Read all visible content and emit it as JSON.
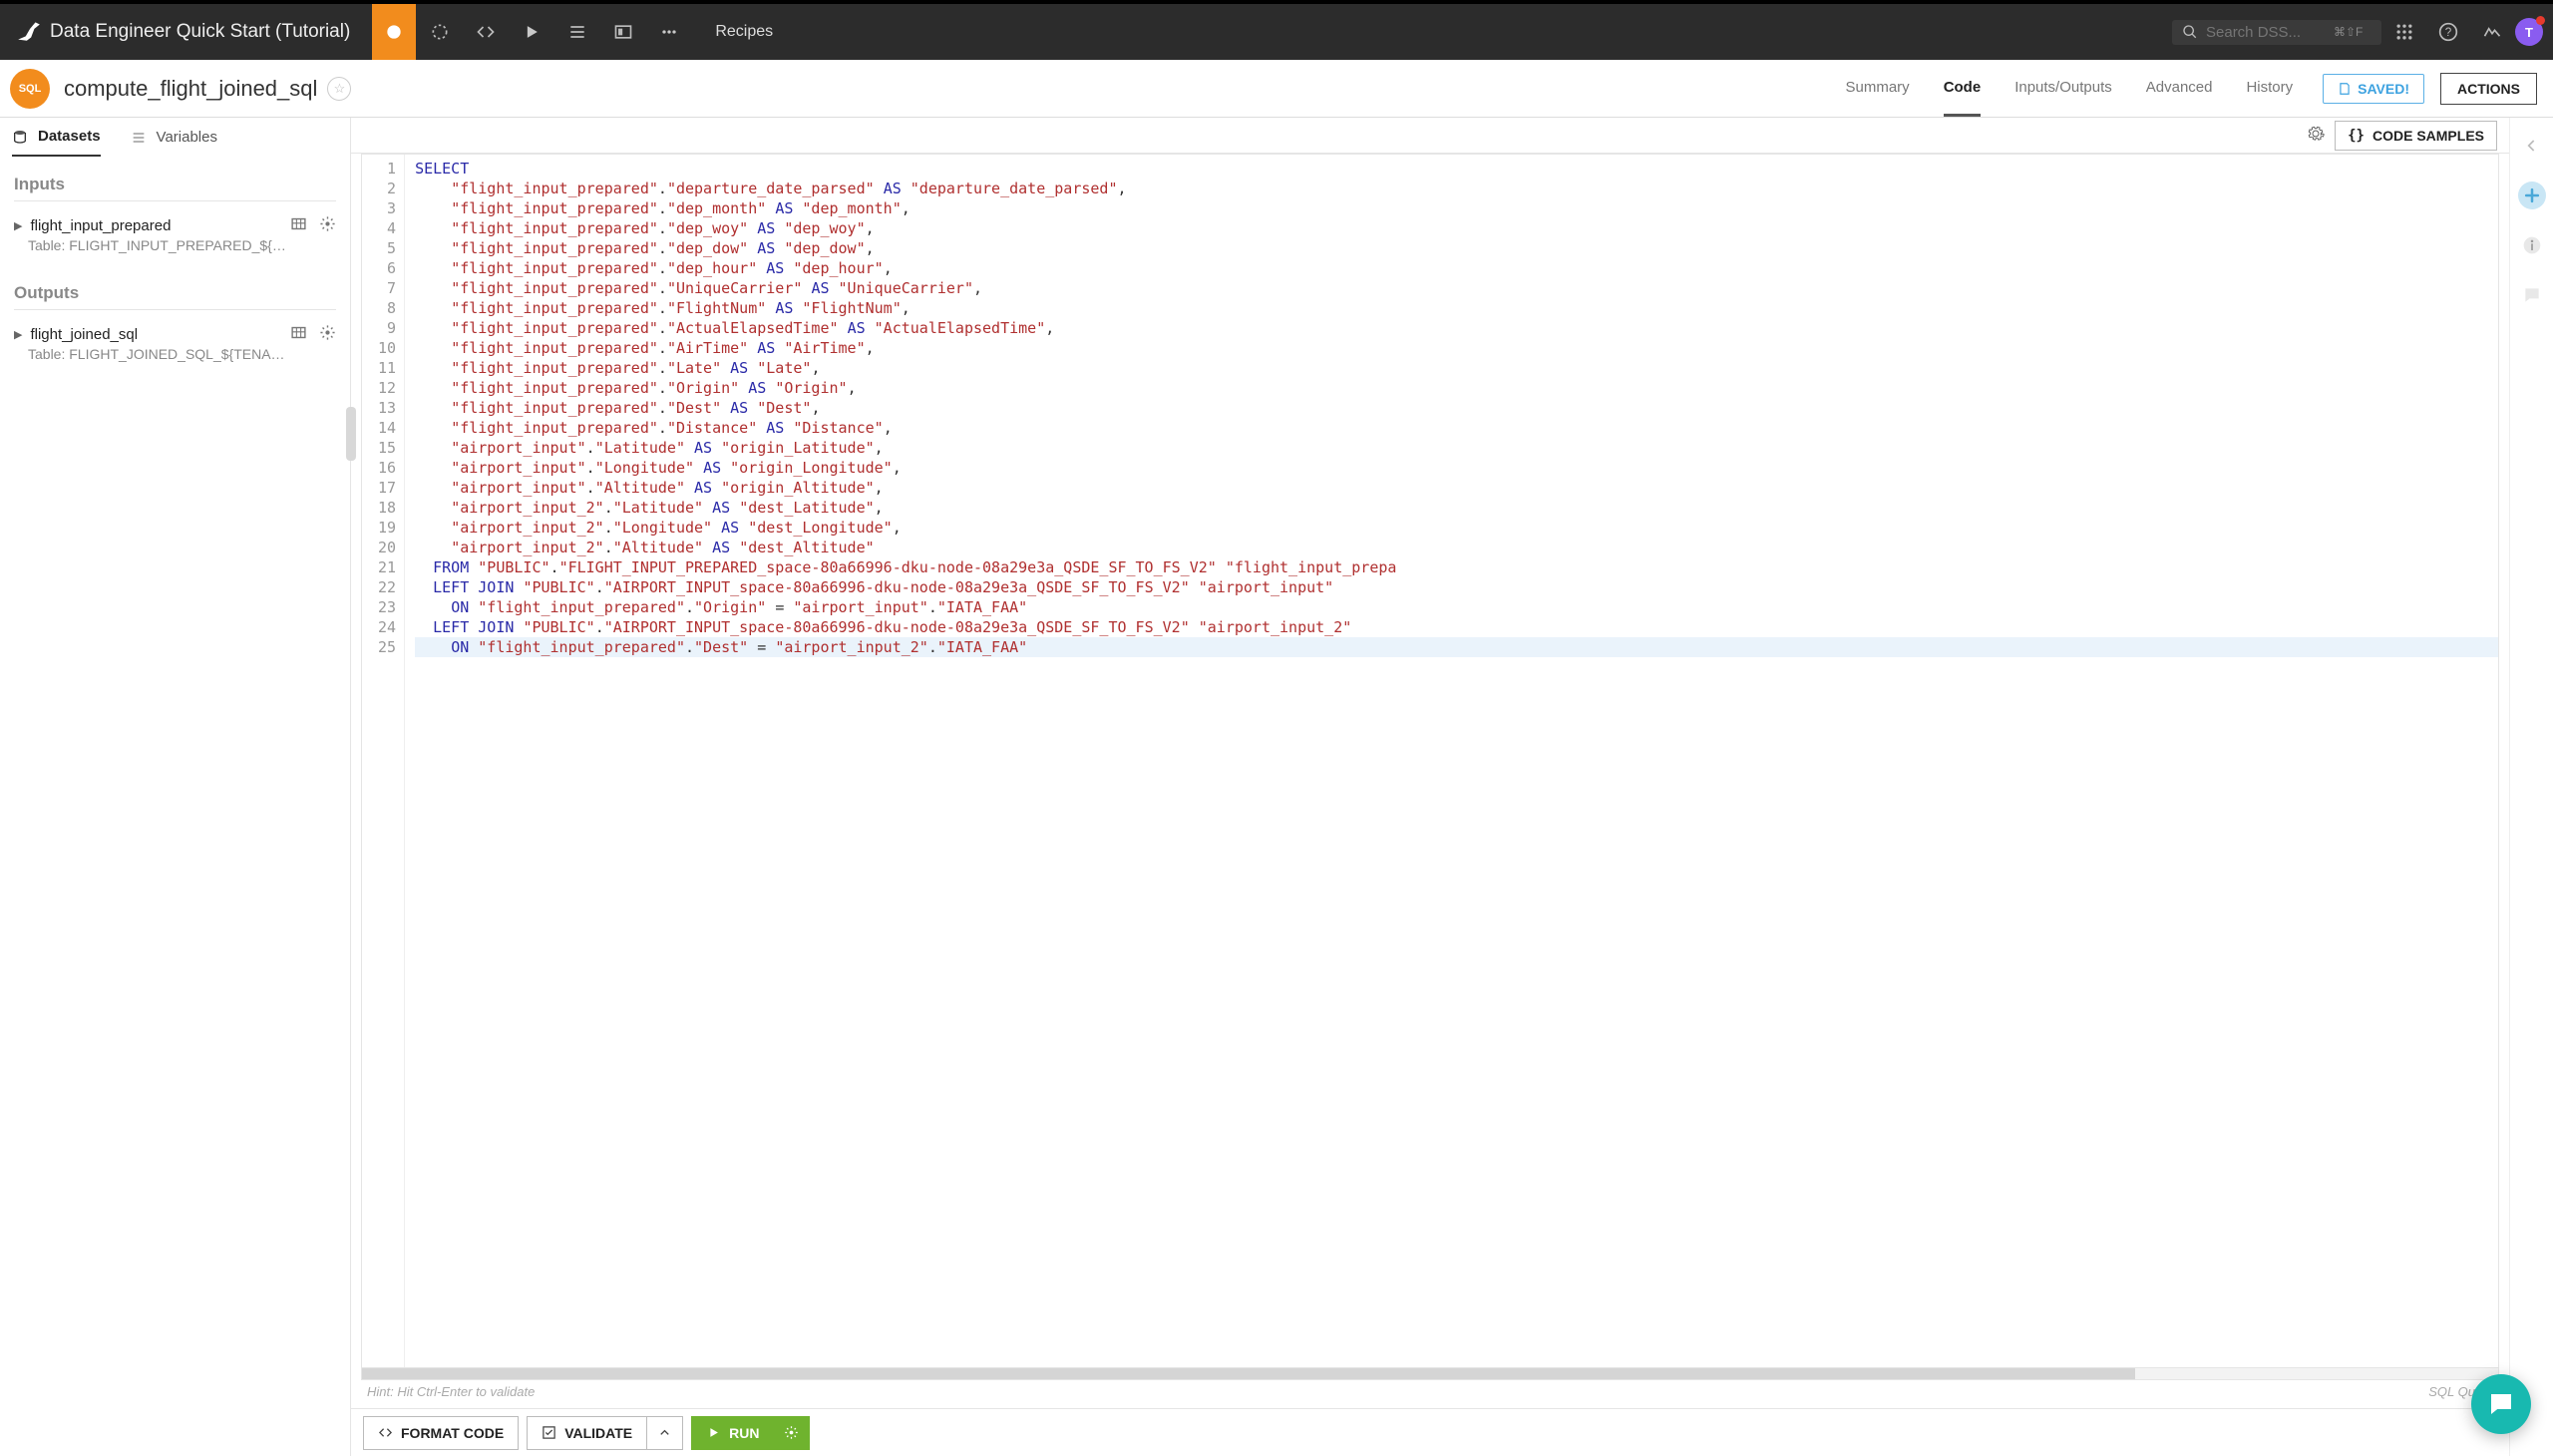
{
  "project_title": "Data Engineer Quick Start (Tutorial)",
  "top_tab": "Recipes",
  "search": {
    "placeholder": "Search DSS...",
    "kbd": "⌘⇧F"
  },
  "avatar_initial": "T",
  "recipe": {
    "chip": "SQL",
    "name": "compute_flight_joined_sql"
  },
  "subtabs": [
    "Summary",
    "Code",
    "Inputs/Outputs",
    "Advanced",
    "History"
  ],
  "subtab_active": 1,
  "saved_label": "SAVED!",
  "actions_label": "ACTIONS",
  "side_tabs": {
    "datasets": "Datasets",
    "variables": "Variables",
    "active": "datasets"
  },
  "inputs_title": "Inputs",
  "outputs_title": "Outputs",
  "inputs": [
    {
      "name": "flight_input_prepared",
      "table": "Table: FLIGHT_INPUT_PREPARED_${…"
    }
  ],
  "outputs": [
    {
      "name": "flight_joined_sql",
      "table": "Table: FLIGHT_JOINED_SQL_${TENA…"
    }
  ],
  "code_samples_label": "CODE SAMPLES",
  "hint": "Hint: Hit Ctrl-Enter to validate",
  "hint_right": "SQL Query",
  "format_label": "FORMAT CODE",
  "validate_label": "VALIDATE",
  "run_label": "RUN",
  "code": {
    "lines": [
      {
        "n": 1,
        "t": [
          [
            "kw",
            "SELECT"
          ]
        ]
      },
      {
        "n": 2,
        "t": [
          [
            "sp",
            "    "
          ],
          [
            "str",
            "\"flight_input_prepared\""
          ],
          [
            "op",
            "."
          ],
          [
            "str",
            "\"departure_date_parsed\""
          ],
          [
            "sp",
            " "
          ],
          [
            "kw",
            "AS"
          ],
          [
            "sp",
            " "
          ],
          [
            "str",
            "\"departure_date_parsed\""
          ],
          [
            "op",
            ","
          ]
        ]
      },
      {
        "n": 3,
        "t": [
          [
            "sp",
            "    "
          ],
          [
            "str",
            "\"flight_input_prepared\""
          ],
          [
            "op",
            "."
          ],
          [
            "str",
            "\"dep_month\""
          ],
          [
            "sp",
            " "
          ],
          [
            "kw",
            "AS"
          ],
          [
            "sp",
            " "
          ],
          [
            "str",
            "\"dep_month\""
          ],
          [
            "op",
            ","
          ]
        ]
      },
      {
        "n": 4,
        "t": [
          [
            "sp",
            "    "
          ],
          [
            "str",
            "\"flight_input_prepared\""
          ],
          [
            "op",
            "."
          ],
          [
            "str",
            "\"dep_woy\""
          ],
          [
            "sp",
            " "
          ],
          [
            "kw",
            "AS"
          ],
          [
            "sp",
            " "
          ],
          [
            "str",
            "\"dep_woy\""
          ],
          [
            "op",
            ","
          ]
        ]
      },
      {
        "n": 5,
        "t": [
          [
            "sp",
            "    "
          ],
          [
            "str",
            "\"flight_input_prepared\""
          ],
          [
            "op",
            "."
          ],
          [
            "str",
            "\"dep_dow\""
          ],
          [
            "sp",
            " "
          ],
          [
            "kw",
            "AS"
          ],
          [
            "sp",
            " "
          ],
          [
            "str",
            "\"dep_dow\""
          ],
          [
            "op",
            ","
          ]
        ]
      },
      {
        "n": 6,
        "t": [
          [
            "sp",
            "    "
          ],
          [
            "str",
            "\"flight_input_prepared\""
          ],
          [
            "op",
            "."
          ],
          [
            "str",
            "\"dep_hour\""
          ],
          [
            "sp",
            " "
          ],
          [
            "kw",
            "AS"
          ],
          [
            "sp",
            " "
          ],
          [
            "str",
            "\"dep_hour\""
          ],
          [
            "op",
            ","
          ]
        ]
      },
      {
        "n": 7,
        "t": [
          [
            "sp",
            "    "
          ],
          [
            "str",
            "\"flight_input_prepared\""
          ],
          [
            "op",
            "."
          ],
          [
            "str",
            "\"UniqueCarrier\""
          ],
          [
            "sp",
            " "
          ],
          [
            "kw",
            "AS"
          ],
          [
            "sp",
            " "
          ],
          [
            "str",
            "\"UniqueCarrier\""
          ],
          [
            "op",
            ","
          ]
        ]
      },
      {
        "n": 8,
        "t": [
          [
            "sp",
            "    "
          ],
          [
            "str",
            "\"flight_input_prepared\""
          ],
          [
            "op",
            "."
          ],
          [
            "str",
            "\"FlightNum\""
          ],
          [
            "sp",
            " "
          ],
          [
            "kw",
            "AS"
          ],
          [
            "sp",
            " "
          ],
          [
            "str",
            "\"FlightNum\""
          ],
          [
            "op",
            ","
          ]
        ]
      },
      {
        "n": 9,
        "t": [
          [
            "sp",
            "    "
          ],
          [
            "str",
            "\"flight_input_prepared\""
          ],
          [
            "op",
            "."
          ],
          [
            "str",
            "\"ActualElapsedTime\""
          ],
          [
            "sp",
            " "
          ],
          [
            "kw",
            "AS"
          ],
          [
            "sp",
            " "
          ],
          [
            "str",
            "\"ActualElapsedTime\""
          ],
          [
            "op",
            ","
          ]
        ]
      },
      {
        "n": 10,
        "t": [
          [
            "sp",
            "    "
          ],
          [
            "str",
            "\"flight_input_prepared\""
          ],
          [
            "op",
            "."
          ],
          [
            "str",
            "\"AirTime\""
          ],
          [
            "sp",
            " "
          ],
          [
            "kw",
            "AS"
          ],
          [
            "sp",
            " "
          ],
          [
            "str",
            "\"AirTime\""
          ],
          [
            "op",
            ","
          ]
        ]
      },
      {
        "n": 11,
        "t": [
          [
            "sp",
            "    "
          ],
          [
            "str",
            "\"flight_input_prepared\""
          ],
          [
            "op",
            "."
          ],
          [
            "str",
            "\"Late\""
          ],
          [
            "sp",
            " "
          ],
          [
            "kw",
            "AS"
          ],
          [
            "sp",
            " "
          ],
          [
            "str",
            "\"Late\""
          ],
          [
            "op",
            ","
          ]
        ]
      },
      {
        "n": 12,
        "t": [
          [
            "sp",
            "    "
          ],
          [
            "str",
            "\"flight_input_prepared\""
          ],
          [
            "op",
            "."
          ],
          [
            "str",
            "\"Origin\""
          ],
          [
            "sp",
            " "
          ],
          [
            "kw",
            "AS"
          ],
          [
            "sp",
            " "
          ],
          [
            "str",
            "\"Origin\""
          ],
          [
            "op",
            ","
          ]
        ]
      },
      {
        "n": 13,
        "t": [
          [
            "sp",
            "    "
          ],
          [
            "str",
            "\"flight_input_prepared\""
          ],
          [
            "op",
            "."
          ],
          [
            "str",
            "\"Dest\""
          ],
          [
            "sp",
            " "
          ],
          [
            "kw",
            "AS"
          ],
          [
            "sp",
            " "
          ],
          [
            "str",
            "\"Dest\""
          ],
          [
            "op",
            ","
          ]
        ]
      },
      {
        "n": 14,
        "t": [
          [
            "sp",
            "    "
          ],
          [
            "str",
            "\"flight_input_prepared\""
          ],
          [
            "op",
            "."
          ],
          [
            "str",
            "\"Distance\""
          ],
          [
            "sp",
            " "
          ],
          [
            "kw",
            "AS"
          ],
          [
            "sp",
            " "
          ],
          [
            "str",
            "\"Distance\""
          ],
          [
            "op",
            ","
          ]
        ]
      },
      {
        "n": 15,
        "t": [
          [
            "sp",
            "    "
          ],
          [
            "str",
            "\"airport_input\""
          ],
          [
            "op",
            "."
          ],
          [
            "str",
            "\"Latitude\""
          ],
          [
            "sp",
            " "
          ],
          [
            "kw",
            "AS"
          ],
          [
            "sp",
            " "
          ],
          [
            "str",
            "\"origin_Latitude\""
          ],
          [
            "op",
            ","
          ]
        ]
      },
      {
        "n": 16,
        "t": [
          [
            "sp",
            "    "
          ],
          [
            "str",
            "\"airport_input\""
          ],
          [
            "op",
            "."
          ],
          [
            "str",
            "\"Longitude\""
          ],
          [
            "sp",
            " "
          ],
          [
            "kw",
            "AS"
          ],
          [
            "sp",
            " "
          ],
          [
            "str",
            "\"origin_Longitude\""
          ],
          [
            "op",
            ","
          ]
        ]
      },
      {
        "n": 17,
        "t": [
          [
            "sp",
            "    "
          ],
          [
            "str",
            "\"airport_input\""
          ],
          [
            "op",
            "."
          ],
          [
            "str",
            "\"Altitude\""
          ],
          [
            "sp",
            " "
          ],
          [
            "kw",
            "AS"
          ],
          [
            "sp",
            " "
          ],
          [
            "str",
            "\"origin_Altitude\""
          ],
          [
            "op",
            ","
          ]
        ]
      },
      {
        "n": 18,
        "t": [
          [
            "sp",
            "    "
          ],
          [
            "str",
            "\"airport_input_2\""
          ],
          [
            "op",
            "."
          ],
          [
            "str",
            "\"Latitude\""
          ],
          [
            "sp",
            " "
          ],
          [
            "kw",
            "AS"
          ],
          [
            "sp",
            " "
          ],
          [
            "str",
            "\"dest_Latitude\""
          ],
          [
            "op",
            ","
          ]
        ]
      },
      {
        "n": 19,
        "t": [
          [
            "sp",
            "    "
          ],
          [
            "str",
            "\"airport_input_2\""
          ],
          [
            "op",
            "."
          ],
          [
            "str",
            "\"Longitude\""
          ],
          [
            "sp",
            " "
          ],
          [
            "kw",
            "AS"
          ],
          [
            "sp",
            " "
          ],
          [
            "str",
            "\"dest_Longitude\""
          ],
          [
            "op",
            ","
          ]
        ]
      },
      {
        "n": 20,
        "t": [
          [
            "sp",
            "    "
          ],
          [
            "str",
            "\"airport_input_2\""
          ],
          [
            "op",
            "."
          ],
          [
            "str",
            "\"Altitude\""
          ],
          [
            "sp",
            " "
          ],
          [
            "kw",
            "AS"
          ],
          [
            "sp",
            " "
          ],
          [
            "str",
            "\"dest_Altitude\""
          ]
        ]
      },
      {
        "n": 21,
        "t": [
          [
            "sp",
            "  "
          ],
          [
            "kw",
            "FROM"
          ],
          [
            "sp",
            " "
          ],
          [
            "str",
            "\"PUBLIC\""
          ],
          [
            "op",
            "."
          ],
          [
            "str",
            "\"FLIGHT_INPUT_PREPARED_space-80a66996-dku-node-08a29e3a_QSDE_SF_TO_FS_V2\""
          ],
          [
            "sp",
            " "
          ],
          [
            "str",
            "\"flight_input_prepa"
          ]
        ]
      },
      {
        "n": 22,
        "t": [
          [
            "sp",
            "  "
          ],
          [
            "kw",
            "LEFT"
          ],
          [
            "sp",
            " "
          ],
          [
            "kw",
            "JOIN"
          ],
          [
            "sp",
            " "
          ],
          [
            "str",
            "\"PUBLIC\""
          ],
          [
            "op",
            "."
          ],
          [
            "str",
            "\"AIRPORT_INPUT_space-80a66996-dku-node-08a29e3a_QSDE_SF_TO_FS_V2\""
          ],
          [
            "sp",
            " "
          ],
          [
            "str",
            "\"airport_input\""
          ]
        ]
      },
      {
        "n": 23,
        "t": [
          [
            "sp",
            "    "
          ],
          [
            "kw",
            "ON"
          ],
          [
            "sp",
            " "
          ],
          [
            "str",
            "\"flight_input_prepared\""
          ],
          [
            "op",
            "."
          ],
          [
            "str",
            "\"Origin\""
          ],
          [
            "sp",
            " "
          ],
          [
            "op",
            "="
          ],
          [
            "sp",
            " "
          ],
          [
            "str",
            "\"airport_input\""
          ],
          [
            "op",
            "."
          ],
          [
            "str",
            "\"IATA_FAA\""
          ]
        ]
      },
      {
        "n": 24,
        "t": [
          [
            "sp",
            "  "
          ],
          [
            "kw",
            "LEFT"
          ],
          [
            "sp",
            " "
          ],
          [
            "kw",
            "JOIN"
          ],
          [
            "sp",
            " "
          ],
          [
            "str",
            "\"PUBLIC\""
          ],
          [
            "op",
            "."
          ],
          [
            "str",
            "\"AIRPORT_INPUT_space-80a66996-dku-node-08a29e3a_QSDE_SF_TO_FS_V2\""
          ],
          [
            "sp",
            " "
          ],
          [
            "str",
            "\"airport_input_2\""
          ]
        ]
      },
      {
        "n": 25,
        "cur": true,
        "t": [
          [
            "sp",
            "    "
          ],
          [
            "kw",
            "ON"
          ],
          [
            "sp",
            " "
          ],
          [
            "str",
            "\"flight_input_prepared\""
          ],
          [
            "op",
            "."
          ],
          [
            "str",
            "\"Dest\""
          ],
          [
            "sp",
            " "
          ],
          [
            "op",
            "="
          ],
          [
            "sp",
            " "
          ],
          [
            "str",
            "\"airport_input_2\""
          ],
          [
            "op",
            "."
          ],
          [
            "str",
            "\"IATA_FAA\""
          ]
        ]
      }
    ]
  }
}
